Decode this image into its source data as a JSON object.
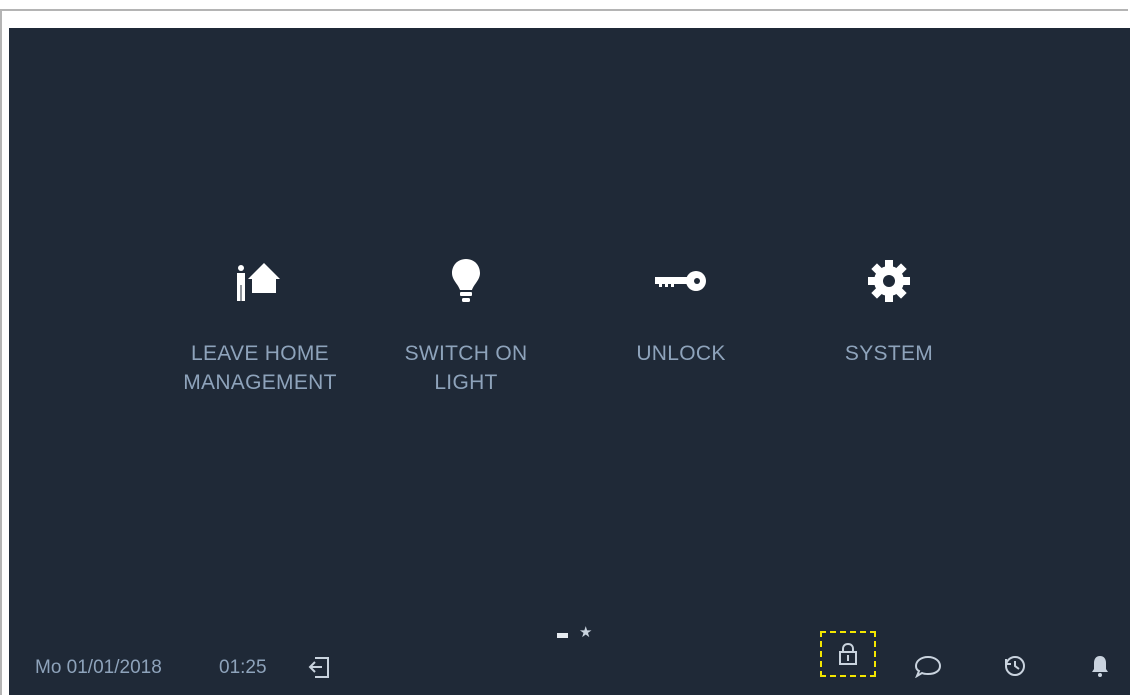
{
  "tiles": [
    {
      "id": "leave-home",
      "label": "LEAVE HOME\nMANAGEMENT",
      "icon": "person-house-icon"
    },
    {
      "id": "switch-light",
      "label": "SWITCH ON\nLIGHT",
      "icon": "lightbulb-icon"
    },
    {
      "id": "unlock",
      "label": "UNLOCK",
      "icon": "key-icon"
    },
    {
      "id": "system",
      "label": "SYSTEM",
      "icon": "gear-icon"
    }
  ],
  "status_bar": {
    "date": "Mo 01/01/2018",
    "time": "01:25",
    "icons": [
      "exit-icon",
      "lock-icon",
      "message-icon",
      "history-icon",
      "bell-icon"
    ]
  },
  "pager": {
    "pages": 2,
    "current": 1
  },
  "colors": {
    "background": "#1f2937",
    "label": "#8ea3bb",
    "icon": "#ffffff",
    "highlight": "#f3e600"
  }
}
